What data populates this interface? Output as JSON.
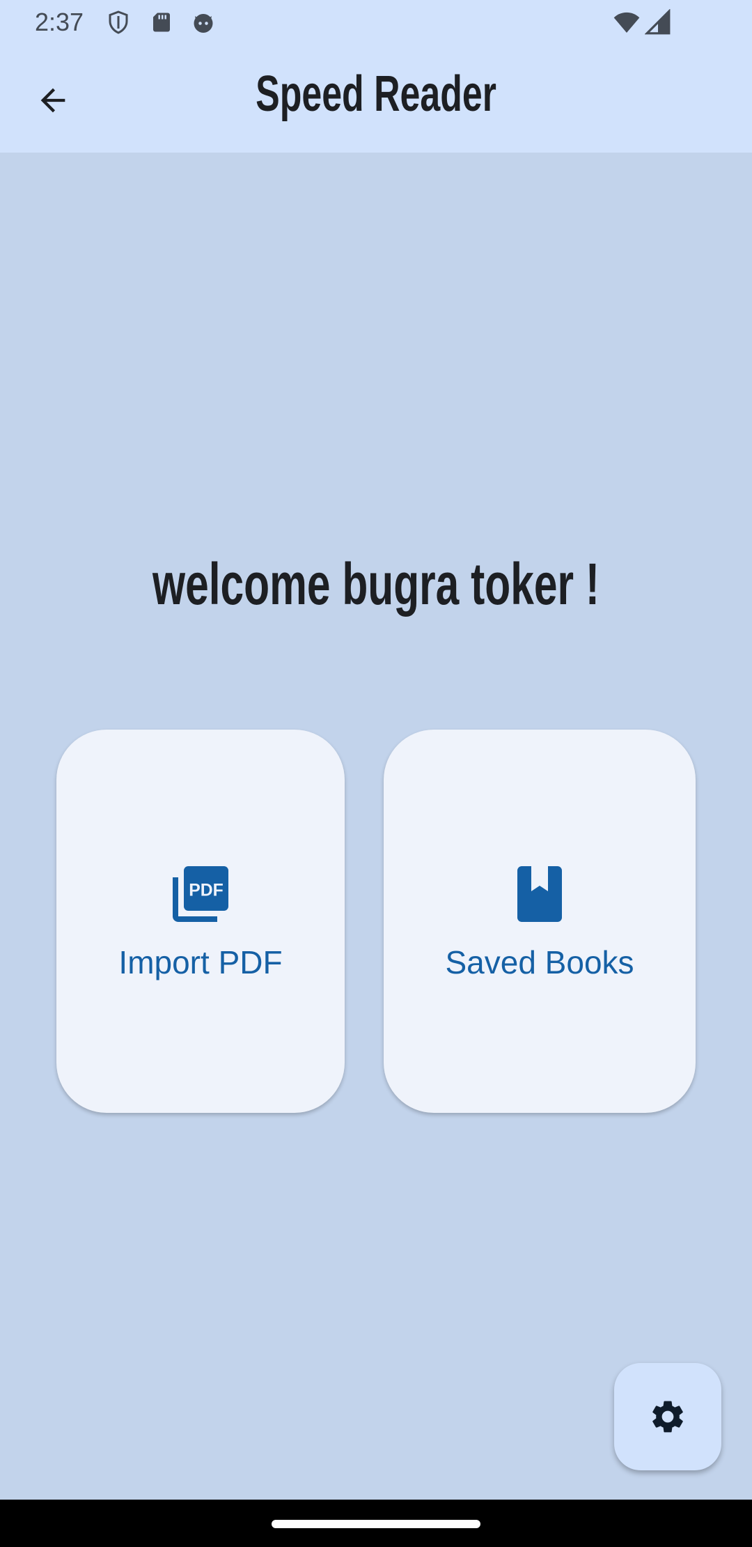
{
  "status_bar": {
    "time": "2:37",
    "icons": [
      "shield-icon",
      "sd-card-icon",
      "cat-face-icon",
      "wifi-icon",
      "signal-icon"
    ]
  },
  "app_bar": {
    "back_icon": "arrow-back-icon",
    "title": "Speed Reader"
  },
  "main": {
    "welcome_text": "welcome bugra toker !",
    "cards": [
      {
        "icon": "pdf-icon",
        "label": "Import PDF"
      },
      {
        "icon": "book-icon",
        "label": "Saved Books"
      }
    ]
  },
  "fab": {
    "icon": "gear-icon"
  },
  "colors": {
    "background": "#c2d3eb",
    "app_bar": "#d1e2fc",
    "card": "#eff3fb",
    "accent": "#1560a5",
    "text": "#1d1f23"
  }
}
